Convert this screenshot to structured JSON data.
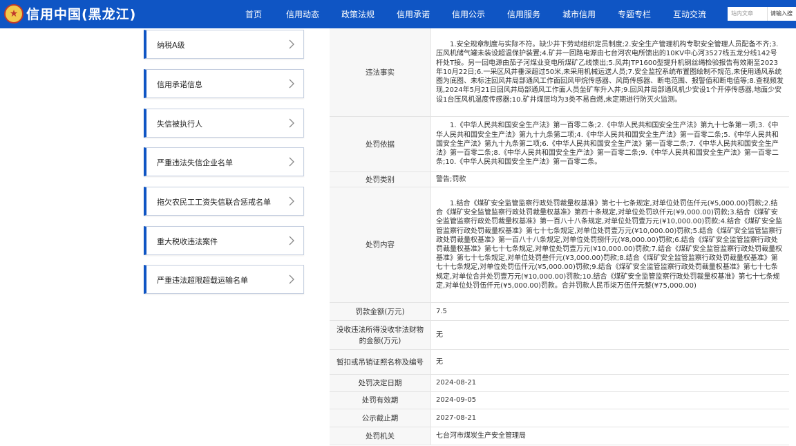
{
  "header": {
    "logo_icon": "national-emblem-icon",
    "title": "信用中国(黑龙江)",
    "nav": [
      "首页",
      "信用动态",
      "政策法规",
      "信用承诺",
      "信用公示",
      "信用服务",
      "城市信用",
      "专题专栏",
      "互动交流"
    ],
    "search_placeholder": "站内文章",
    "search_button": "请输入搜"
  },
  "sidebar": {
    "items": [
      {
        "label": "纳税A级"
      },
      {
        "label": "信用承诺信息"
      },
      {
        "label": "失信被执行人"
      },
      {
        "label": "严重违法失信企业名单"
      },
      {
        "label": "拖欠农民工工资失信联合惩戒名单"
      },
      {
        "label": "重大税收违法案件"
      },
      {
        "label": "严重违法超限超载运输名单"
      }
    ],
    "chevron_icon": "chevron-right-icon"
  },
  "detail": {
    "rows": [
      {
        "key": "违法事实",
        "value": "1.安全规章制度与实际不符。缺少井下劳动组织定员制度;2.安全生产管理机构专职安全管理人员配备不齐;3.压风机储气罐未装设超温保护装置;4.矿井一回路电源由七台河农电所馈出的10KV中心河3527线五龙分线142号杆处T接。另一回电源由茄子河煤业变电所煤矿乙线馈出;5.风井JTP1600型提升机钢丝绳检验报告有效期至2023年10月22日;6.一采区风井垂深超过50米,未采用机械运送人员;7.安全监控系统布置图绘制不规范,未使用通风系统图为底图、未标注回风井局部通风工作面回风甲烷传感器、风筒传感器、断电范围、报警值和断电值等;8.查视频发现,2024年5月21日回风井局部通风工作面人员坐矿车升入井;9.回风井局部通风机少安设1个开停传感器,地面少安设1台压风机温度传感器;10.矿井煤层均为3类不易自燃,未定期进行防灭火监测。"
      },
      {
        "key": "处罚依据",
        "value": "1.《中华人民共和国安全生产法》第一百零二条;2.《中华人民共和国安全生产法》第九十七条第一项;3.《中华人民共和国安全生产法》第九十九条第二项;4.《中华人民共和国安全生产法》第一百零二条;5.《中华人民共和国安全生产法》第九十九条第二项;6.《中华人民共和国安全生产法》第一百零二条;7.《中华人民共和国安全生产法》第一百零二条;8.《中华人民共和国安全生产法》第一百零二条;9.《中华人民共和国安全生产法》第一百零二条;10.《中华人民共和国安全生产法》第一百零二条。"
      },
      {
        "key": "处罚类别",
        "value": "警告;罚款"
      },
      {
        "key": "处罚内容",
        "value": "1.结合《煤矿安全监管监察行政处罚裁量权基准》第七十七条规定,对单位处罚伍仟元(¥5,000.00)罚款;2.结合《煤矿安全监管监察行政处罚裁量权基准》第四十条规定,对单位处罚玖仟元(¥9,000.00)罚款;3.结合《煤矿安全监管监察行政处罚裁量权基准》第一百八十八条规定,对单位处罚壹万元(¥10,000.00)罚款;4.结合《煤矿安全监管监察行政处罚裁量权基准》第七十七条规定,对单位处罚壹万元(¥10,000.00)罚款;5.结合《煤矿安全监管监察行政处罚裁量权基准》第一百八十八条规定,对单位处罚捌仟元(¥8,000.00)罚款;6.结合《煤矿安全监管监察行政处罚裁量权基准》第七十七条规定,对单位处罚壹万元(¥10,000.00)罚款;7.结合《煤矿安全监管监察行政处罚裁量权基准》第七十七条规定,对单位处罚叁仟元(¥3,000.00)罚款;8.结合《煤矿安全监管监察行政处罚裁量权基准》第七十七条规定,对单位处罚伍仟元(¥5,000.00)罚款;9.结合《煤矿安全监管监察行政处罚裁量权基准》第七十七条规定,对单位合并处罚壹万元(¥10,000.00)罚款;10.结合《煤矿安全监管监察行政处罚裁量权基准》第七十七条规定,对单位处罚伍仟元(¥5,000.00)罚款。合并罚款人民币柒万伍仟元整(¥75,000.00)"
      },
      {
        "key": "罚款金额(万元)",
        "value": "7.5"
      },
      {
        "key": "没收违法所得没收非法财物的金额(万元)",
        "value": "无"
      },
      {
        "key": "暂扣或吊销证照名称及编号",
        "value": "无"
      },
      {
        "key": "处罚决定日期",
        "value": "2024-08-21"
      },
      {
        "key": "处罚有效期",
        "value": "2024-09-05"
      },
      {
        "key": "公示截止期",
        "value": "2027-08-21"
      },
      {
        "key": "处罚机关",
        "value": "七台河市煤炭生产安全管理局"
      }
    ]
  },
  "colors": {
    "header_bg": "#0f55c4",
    "accent": "#0f55c4",
    "key_bg": "#f7f7f7"
  }
}
